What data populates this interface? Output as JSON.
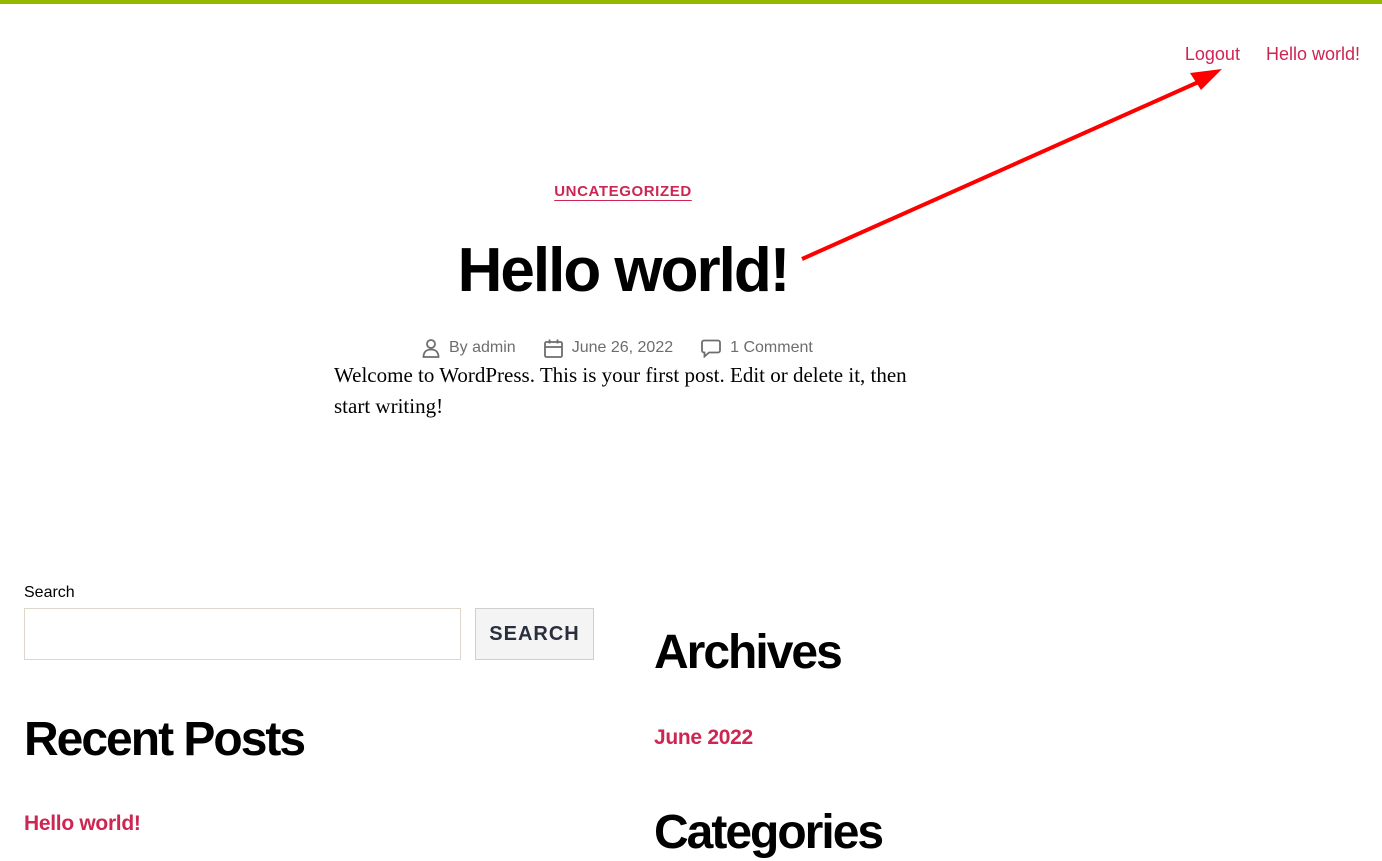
{
  "colors": {
    "accent": "#cd2653",
    "top_bar": "#94b800",
    "meta_text": "#6d6d6d",
    "button_bg": "#f4f4f4",
    "annotation_arrow": "#ff0000"
  },
  "nav": {
    "items": [
      {
        "label": "Logout"
      },
      {
        "label": "Hello world!"
      }
    ]
  },
  "post": {
    "category": "UNCATEGORIZED",
    "title": "Hello world!",
    "meta": {
      "author_prefix": "By",
      "author": "admin",
      "date": "June 26, 2022",
      "comments": "1 Comment"
    },
    "content": "Welcome to WordPress. This is your first post. Edit or delete it, then start writing!"
  },
  "search": {
    "label": "Search",
    "value": "",
    "placeholder": "",
    "button_label": "SEARCH"
  },
  "recent_posts": {
    "heading": "Recent Posts",
    "items": [
      {
        "label": "Hello world!"
      }
    ]
  },
  "archives": {
    "heading": "Archives",
    "items": [
      {
        "label": "June 2022"
      }
    ]
  },
  "categories": {
    "heading": "Categories"
  },
  "icons": {
    "author": "person-icon",
    "date": "calendar-icon",
    "comments": "comment-bubble-icon"
  }
}
